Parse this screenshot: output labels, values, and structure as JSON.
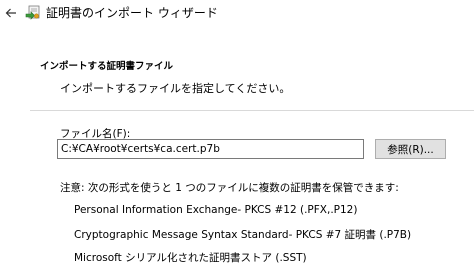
{
  "titlebar": {
    "title": "証明書のインポート ウィザード"
  },
  "header": {
    "title": "インポートする証明書ファイル",
    "description": "インポートするファイルを指定してください。"
  },
  "file": {
    "label": "ファイル名(F):",
    "value": "C:¥CA¥root¥certs¥ca.cert.p7b",
    "browse_label": "参照(R)..."
  },
  "note": "注意: 次の形式を使うと 1 つのファイルに複数の証明書を保管できます:",
  "formats": [
    "Personal Information Exchange- PKCS #12 (.PFX,.P12)",
    "Cryptographic Message Syntax Standard- PKCS #7 証明書 (.P7B)",
    "Microsoft シリアル化された証明書ストア (.SST)"
  ],
  "icons": {
    "back": "back-arrow-icon",
    "wizard": "certificate-wizard-icon"
  }
}
